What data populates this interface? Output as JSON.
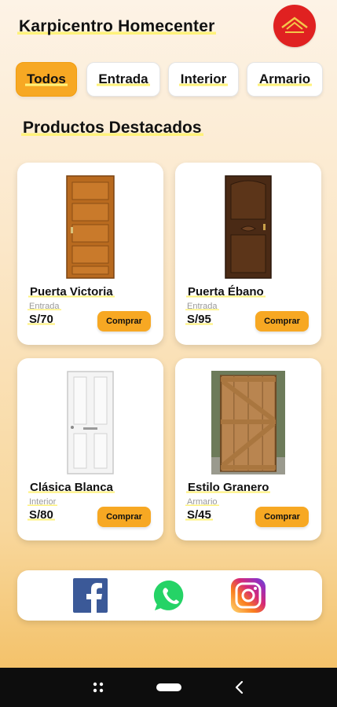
{
  "app": {
    "title": "Karpicentro Homecenter"
  },
  "filters": {
    "items": [
      "Todos",
      "Entrada",
      "Interior",
      "Armario"
    ],
    "selected": "Todos"
  },
  "section": {
    "title": "Productos Destacados"
  },
  "products": [
    {
      "name": "Puerta Victoria",
      "category": "Entrada",
      "price": "S/70",
      "buy_label": "Comprar",
      "image_icon": "wood-door-paneled-icon"
    },
    {
      "name": "Puerta Ébano",
      "category": "Entrada",
      "price": "S/95",
      "buy_label": "Comprar",
      "image_icon": "dark-wood-door-icon"
    },
    {
      "name": "Clásica Blanca",
      "category": "Interior",
      "price": "S/80",
      "buy_label": "Comprar",
      "image_icon": "white-door-icon"
    },
    {
      "name": "Estilo Granero",
      "category": "Armario",
      "price": "S/45",
      "buy_label": "Comprar",
      "image_icon": "barn-door-icon"
    }
  ],
  "social": {
    "icons": [
      "facebook-icon",
      "whatsapp-icon",
      "instagram-icon"
    ]
  },
  "colors": {
    "accent": "#f7a823",
    "highlight": "#fff27a",
    "logo": "#e02121"
  }
}
